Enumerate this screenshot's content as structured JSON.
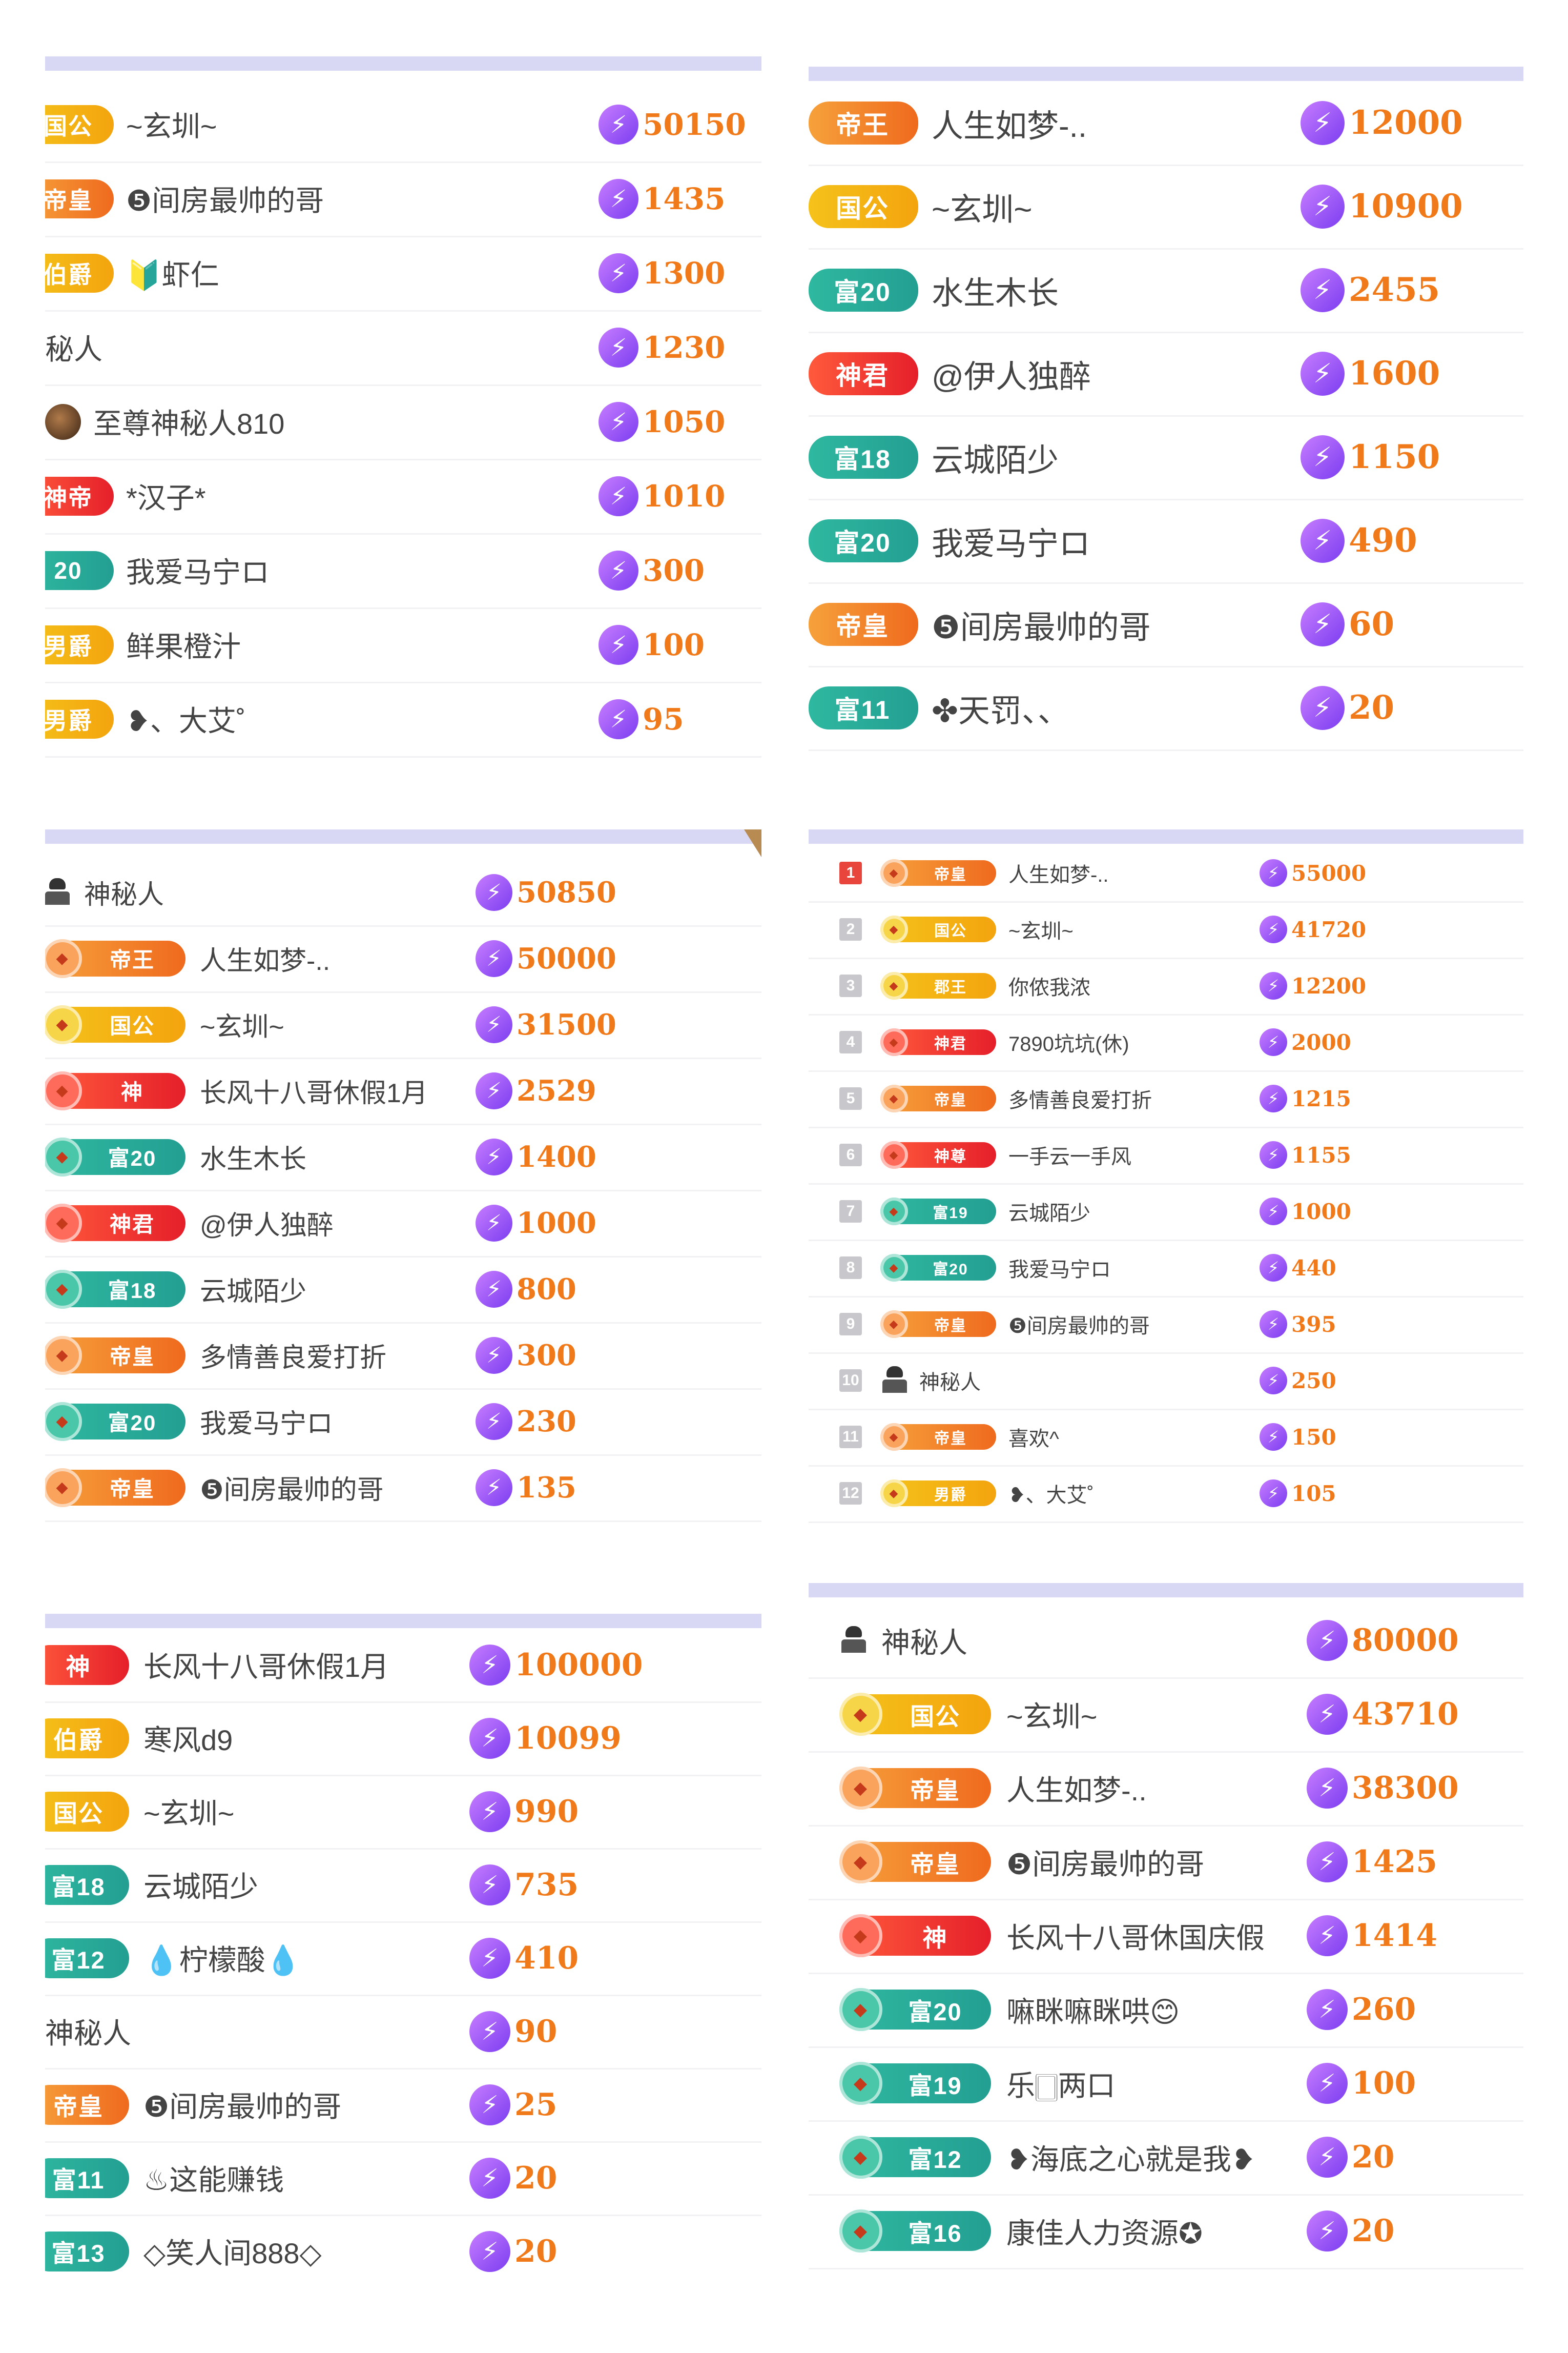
{
  "colors": {
    "header_bar": "#d9d8f4",
    "amount": "#f07a1a",
    "gift_icon": "#8a4cf5",
    "rank_first": "#e8453c",
    "rank_other": "#c8c8cc"
  },
  "icons": {
    "gift": "lightning-coin-icon",
    "mystery": "mystery-person-icon",
    "medal": "rank-medal-icon"
  },
  "panels": [
    {
      "rows": [
        {
          "badge": "国公",
          "tier": "gold",
          "name": "~玄圳~",
          "amount": "50150"
        },
        {
          "badge": "帝皇",
          "tier": "orange",
          "name": "❺间房最帅的哥",
          "amount": "1435"
        },
        {
          "badge": "伯爵",
          "tier": "gold",
          "name": "🔰虾仁",
          "amount": "1300"
        },
        {
          "badge": "",
          "tier": "none",
          "name": "秘人",
          "amount": "1230"
        },
        {
          "badge": "",
          "tier": "avatar",
          "name": "至尊神秘人810",
          "amount": "1050"
        },
        {
          "badge": "神帝",
          "tier": "red",
          "name": "*汉子*",
          "amount": "1010"
        },
        {
          "badge": "20",
          "tier": "green",
          "name": "我爱马宁ロ",
          "amount": "300"
        },
        {
          "badge": "男爵",
          "tier": "gold",
          "name": "鲜果橙汁",
          "amount": "100"
        },
        {
          "badge": "男爵",
          "tier": "gold",
          "name": "❥、大艾˚",
          "amount": "95"
        }
      ]
    },
    {
      "rows": [
        {
          "badge": "帝王",
          "tier": "orange",
          "name": "人生如梦-..",
          "amount": "12000"
        },
        {
          "badge": "国公",
          "tier": "gold",
          "name": "~玄圳~",
          "amount": "10900"
        },
        {
          "badge": "富20",
          "tier": "green",
          "name": "水生木长",
          "amount": "2455"
        },
        {
          "badge": "神君",
          "tier": "red",
          "name": "@伊人独醉",
          "amount": "1600"
        },
        {
          "badge": "富18",
          "tier": "green",
          "name": "云城陌少",
          "amount": "1150"
        },
        {
          "badge": "富20",
          "tier": "green",
          "name": "我爱马宁ロ",
          "amount": "490"
        },
        {
          "badge": "帝皇",
          "tier": "orange",
          "name": "❺间房最帅的哥",
          "amount": "60"
        },
        {
          "badge": "富11",
          "tier": "green",
          "name": "✤天罚、、",
          "amount": "20"
        }
      ]
    },
    {
      "rows": [
        {
          "badge": "",
          "tier": "mystery",
          "name": "神秘人",
          "amount": "50850"
        },
        {
          "badge": "帝王",
          "tier": "orange",
          "name": "人生如梦-..",
          "amount": "50000"
        },
        {
          "badge": "国公",
          "tier": "gold",
          "name": "~玄圳~",
          "amount": "31500"
        },
        {
          "badge": "神",
          "tier": "red",
          "name": "长风十八哥休假1月",
          "amount": "2529"
        },
        {
          "badge": "富20",
          "tier": "green",
          "name": "水生木长",
          "amount": "1400"
        },
        {
          "badge": "神君",
          "tier": "red",
          "name": "@伊人独醉",
          "amount": "1000"
        },
        {
          "badge": "富18",
          "tier": "green",
          "name": "云城陌少",
          "amount": "800"
        },
        {
          "badge": "帝皇",
          "tier": "orange",
          "name": "多情善良爱打折",
          "amount": "300"
        },
        {
          "badge": "富20",
          "tier": "green",
          "name": "我爱马宁ロ",
          "amount": "230"
        },
        {
          "badge": "帝皇",
          "tier": "orange",
          "name": "❺间房最帅的哥",
          "amount": "135"
        }
      ]
    },
    {
      "rows": [
        {
          "rank": "1",
          "badge": "帝皇",
          "tier": "orange",
          "name": "人生如梦-..",
          "amount": "55000"
        },
        {
          "rank": "2",
          "badge": "国公",
          "tier": "gold",
          "name": "~玄圳~",
          "amount": "41720"
        },
        {
          "rank": "3",
          "badge": "郡王",
          "tier": "gold",
          "name": "你侬我浓",
          "amount": "12200"
        },
        {
          "rank": "4",
          "badge": "神君",
          "tier": "red",
          "name": "7890坑坑(休)",
          "amount": "2000"
        },
        {
          "rank": "5",
          "badge": "帝皇",
          "tier": "orange",
          "name": "多情善良爱打折",
          "amount": "1215"
        },
        {
          "rank": "6",
          "badge": "神尊",
          "tier": "red",
          "name": "一手云一手风",
          "amount": "1155"
        },
        {
          "rank": "7",
          "badge": "富19",
          "tier": "green",
          "name": "云城陌少",
          "amount": "1000"
        },
        {
          "rank": "8",
          "badge": "富20",
          "tier": "green",
          "name": "我爱马宁ロ",
          "amount": "440"
        },
        {
          "rank": "9",
          "badge": "帝皇",
          "tier": "orange",
          "name": "❺间房最帅的哥",
          "amount": "395"
        },
        {
          "rank": "10",
          "badge": "",
          "tier": "mystery",
          "name": "神秘人",
          "amount": "250"
        },
        {
          "rank": "11",
          "badge": "帝皇",
          "tier": "orange",
          "name": "喜欢^",
          "amount": "150"
        },
        {
          "rank": "12",
          "badge": "男爵",
          "tier": "gold",
          "name": "❥、大艾˚",
          "amount": "105"
        }
      ]
    },
    {
      "rows": [
        {
          "badge": "神",
          "tier": "red",
          "name": "长风十八哥休假1月",
          "amount": "100000"
        },
        {
          "badge": "伯爵",
          "tier": "gold",
          "name": "寒风d9",
          "amount": "10099"
        },
        {
          "badge": "国公",
          "tier": "gold",
          "name": "~玄圳~",
          "amount": "990"
        },
        {
          "badge": "富18",
          "tier": "green",
          "name": "云城陌少",
          "amount": "735"
        },
        {
          "badge": "富12",
          "tier": "green",
          "name": "💧柠檬酸💧",
          "amount": "410"
        },
        {
          "badge": "",
          "tier": "none",
          "name": "神秘人",
          "amount": "90"
        },
        {
          "badge": "帝皇",
          "tier": "orange",
          "name": "❺间房最帅的哥",
          "amount": "25"
        },
        {
          "badge": "富11",
          "tier": "green",
          "name": "♨这能赚钱",
          "amount": "20"
        },
        {
          "badge": "富13",
          "tier": "green",
          "name": "◇笑人间888◇",
          "amount": "20"
        }
      ]
    },
    {
      "rows": [
        {
          "badge": "",
          "tier": "mystery",
          "name": "神秘人",
          "amount": "80000"
        },
        {
          "badge": "国公",
          "tier": "gold",
          "name": "~玄圳~",
          "amount": "43710"
        },
        {
          "badge": "帝皇",
          "tier": "orange",
          "name": "人生如梦-..",
          "amount": "38300"
        },
        {
          "badge": "帝皇",
          "tier": "orange",
          "name": "❺间房最帅的哥",
          "amount": "1425"
        },
        {
          "badge": "神",
          "tier": "red",
          "name": "长风十八哥休国庆假",
          "amount": "1414"
        },
        {
          "badge": "富20",
          "tier": "green",
          "name": "嘛眯嘛眯哄😊",
          "amount": "260"
        },
        {
          "badge": "富19",
          "tier": "green",
          "name": "乐🀆两口",
          "amount": "100"
        },
        {
          "badge": "富12",
          "tier": "green",
          "name": "❥海底之心就是我❥",
          "amount": "20"
        },
        {
          "badge": "富16",
          "tier": "green",
          "name": "康佳人力资源✪",
          "amount": "20"
        }
      ]
    }
  ]
}
